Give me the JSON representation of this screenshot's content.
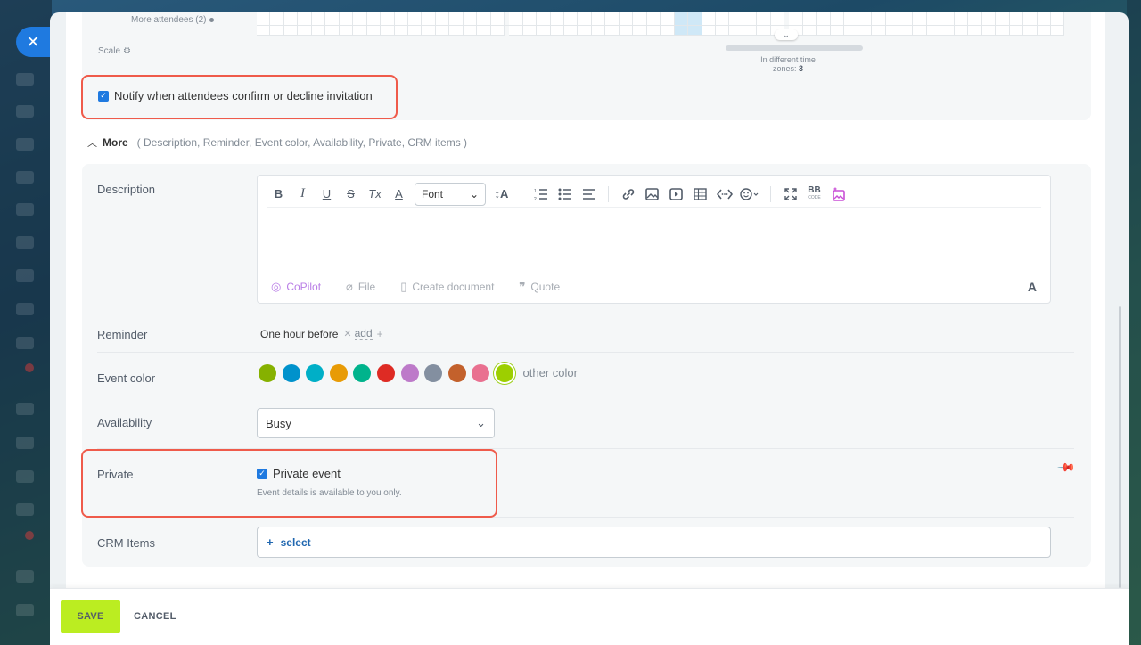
{
  "close_button": {
    "icon": "close-icon",
    "glyph": "✕"
  },
  "schedule": {
    "more_attendees": "More attendees (2)",
    "scale_label": "Scale",
    "timezone_note_prefix": "In different time",
    "timezone_note_suffix": "zones:",
    "timezone_count": "3"
  },
  "notify": {
    "label": "Notify when attendees confirm or decline invitation",
    "checked": true
  },
  "more": {
    "title": "More",
    "list": "( Description,  Reminder,  Event color,  Availability,  Private,  CRM items )"
  },
  "description": {
    "label": "Description",
    "toolbar": {
      "bold": "B",
      "italic": "I",
      "underline": "U",
      "strike": "S",
      "clear": "Tx",
      "color": "A",
      "font": "Font",
      "font_size": "↕A",
      "bb_code": "BB"
    },
    "footer": {
      "copilot": "CoPilot",
      "file": "File",
      "create_document": "Create document",
      "quote": "Quote",
      "text_format": "A"
    }
  },
  "reminder": {
    "label": "Reminder",
    "value": "One hour before",
    "add": "add"
  },
  "event_color": {
    "label": "Event color",
    "swatches": [
      "#86b100",
      "#0092cc",
      "#00afc7",
      "#e89b06",
      "#00b38c",
      "#de2b24",
      "#bd7ac9",
      "#838fa0",
      "#c3612c",
      "#e97090",
      "#9dcf00"
    ],
    "selected_index": 10,
    "other": "other color"
  },
  "availability": {
    "label": "Availability",
    "value": "Busy"
  },
  "private": {
    "label": "Private",
    "checkbox_label": "Private event",
    "checked": true,
    "hint": "Event details is available to you only."
  },
  "crm": {
    "label": "CRM Items",
    "select": "select"
  },
  "footer": {
    "save": "SAVE",
    "cancel": "CANCEL"
  },
  "colors": {
    "accent": "#1f7ae0",
    "highlight": "#ef5b4b",
    "save_bg": "#bbed21"
  }
}
